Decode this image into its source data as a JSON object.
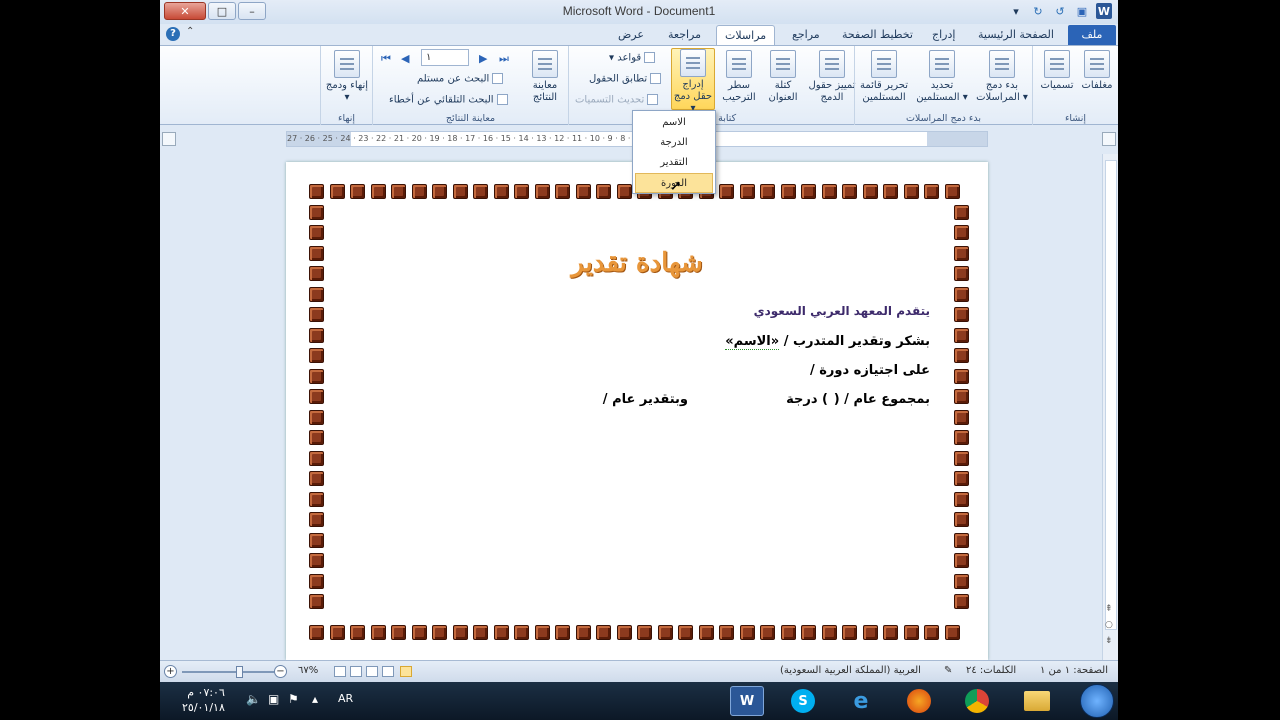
{
  "window": {
    "title": "Microsoft Word  -  Document1"
  },
  "tabs": [
    {
      "label": "ملف",
      "active": false
    },
    {
      "label": "الصفحة الرئيسية",
      "active": false
    },
    {
      "label": "إدراج",
      "active": false
    },
    {
      "label": "تخطيط الصفحة",
      "active": false
    },
    {
      "label": "مراجع",
      "active": false
    },
    {
      "label": "مراسلات",
      "active": true
    },
    {
      "label": "مراجعة",
      "active": false
    },
    {
      "label": "عرض",
      "active": false
    }
  ],
  "ribbon": {
    "create_group": {
      "label": "إنشاء",
      "envelopes": "مغلفات",
      "labels": "تسميات"
    },
    "start_group": {
      "label": "بدء دمج المراسلات",
      "start_merge": "بدء دمج المراسلات",
      "select_recipients": "تحديد المستلمين",
      "edit_list": "تحرير قائمة المستلمين"
    },
    "write_group": {
      "label": "كتابة الحقول",
      "highlight": "تمييز حقول الدمج",
      "address_block": "كتلة العنوان",
      "greeting_line": "سطر الترحيب",
      "insert_field": "إدراج حقل دمج",
      "rules": "قواعد",
      "match_fields": "تطابق الحقول",
      "update_labels": "تحديث التسميات"
    },
    "preview_group": {
      "label": "معاينة النتائج",
      "preview_results": "معاينة النتائج",
      "record_value": "١",
      "find_recipient": "البحث عن مستلم",
      "auto_check": "البحث التلقائي عن أخطاء"
    },
    "finish_group": {
      "label": "إنهاء",
      "finish_merge": "إنهاء ودمج"
    }
  },
  "ruler": {
    "ticks": "27 · 26 · 25 · 24 · 23 · 22 · 21 · 20 · 19 · 18 · 17 · 16 · 15 · 14 · 13 · 12 · 11 · 10 · 9 · 8 · 7 · 6 · 5 · 4 · 3 · 2 · 1"
  },
  "dropdown": {
    "items": [
      {
        "label": "الاسم",
        "hover": false
      },
      {
        "label": "الدرجة",
        "hover": false
      },
      {
        "label": "التقدير",
        "hover": false
      },
      {
        "label": "الدورة",
        "hover": true
      }
    ]
  },
  "document": {
    "title": "شهادة تقدير",
    "org_line": "يتقدم المعهد العربي السعودي",
    "line1_prefix": "بشكر وتقدير المتدرب / ",
    "line1_field": "«الاسم»",
    "line2": "على اجتيازه دورة /",
    "line3_a": "بمجموع عام /  (",
    "line3_b": ")  درجة",
    "line3_c": "وبتقدير عام /"
  },
  "statusbar": {
    "page": "الصفحة: ١ من ١",
    "words": "الكلمات: ٢٤",
    "language": "العربية (المملكة العربية السعودية)",
    "zoom": "%٦٧"
  },
  "taskbar": {
    "time": "٠٧:٠٦ م",
    "date": "٢٥/٠١/١٨",
    "lang": "AR"
  },
  "colors": {
    "accent": "#2b64b7",
    "border_tile": "#8c3a1e",
    "title_orange": "#e8963a"
  }
}
